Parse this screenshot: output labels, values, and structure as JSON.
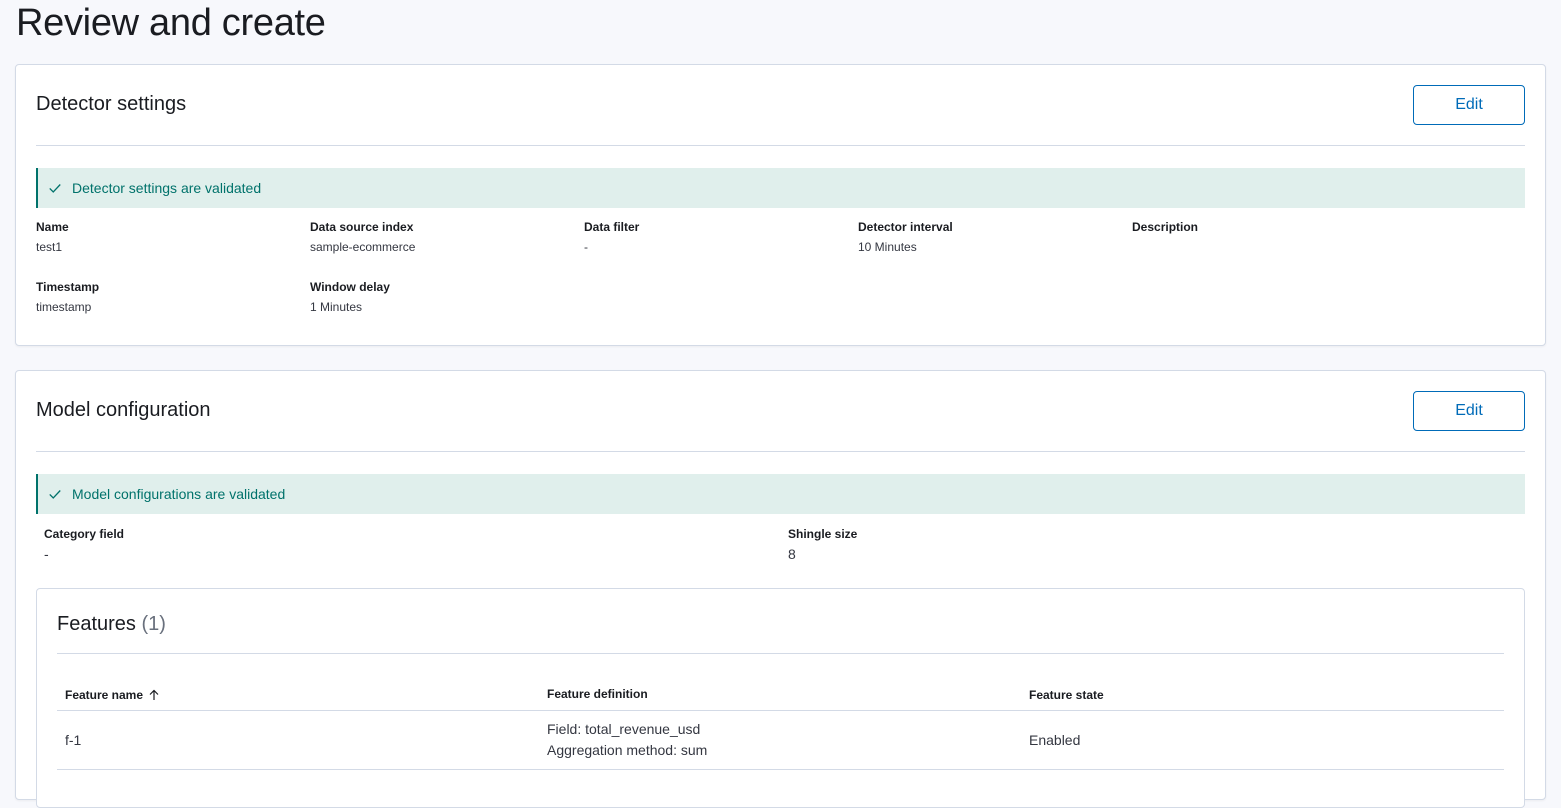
{
  "page": {
    "title": "Review and create"
  },
  "detector_settings": {
    "title": "Detector settings",
    "edit_label": "Edit",
    "callout": "Detector settings are validated",
    "fields": {
      "name": {
        "label": "Name",
        "value": "test1"
      },
      "data_source_index": {
        "label": "Data source index",
        "value": "sample-ecommerce"
      },
      "data_filter": {
        "label": "Data filter",
        "value": "-"
      },
      "detector_interval": {
        "label": "Detector interval",
        "value": "10 Minutes"
      },
      "description": {
        "label": "Description",
        "value": ""
      },
      "timestamp": {
        "label": "Timestamp",
        "value": "timestamp"
      },
      "window_delay": {
        "label": "Window delay",
        "value": "1 Minutes"
      }
    }
  },
  "model_configuration": {
    "title": "Model configuration",
    "edit_label": "Edit",
    "callout": "Model configurations are validated",
    "category_field": {
      "label": "Category field",
      "value": "-"
    },
    "shingle_size": {
      "label": "Shingle size",
      "value": "8"
    },
    "features": {
      "title": "Features",
      "count": "(1)",
      "columns": [
        "Feature name",
        "Feature definition",
        "Feature state"
      ],
      "rows": [
        {
          "name": "f-1",
          "definition_line1": "Field: total_revenue_usd",
          "definition_line2": "Aggregation method: sum",
          "state": "Enabled"
        }
      ]
    }
  },
  "colors": {
    "accent": "#006bb8",
    "success": "#00726b",
    "success_bg": "#e0efec",
    "border": "#d3dae6"
  },
  "icons": {
    "callout": "check-icon",
    "sort": "arrow-up-icon"
  }
}
